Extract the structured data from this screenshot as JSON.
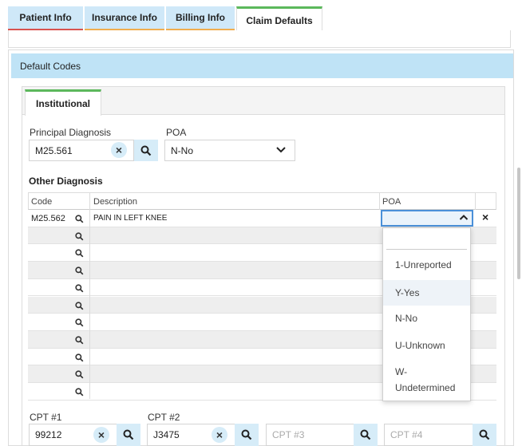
{
  "tabs": [
    {
      "label": "Patient Info",
      "underline": "#d9534f"
    },
    {
      "label": "Insurance Info",
      "underline": "#f0ad4e"
    },
    {
      "label": "Billing Info",
      "underline": "#f0ad4e"
    },
    {
      "label": "Claim Defaults",
      "underline": "#5cb85c"
    }
  ],
  "section": {
    "title": "Default Codes"
  },
  "inner_tab": {
    "label": "Institutional"
  },
  "principal": {
    "label": "Principal Diagnosis",
    "value": "M25.561",
    "poa_label": "POA",
    "poa_value": "N-No"
  },
  "other": {
    "title": "Other Diagnosis",
    "headers": {
      "code": "Code",
      "description": "Description",
      "poa": "POA"
    },
    "rows": [
      {
        "code": "M25.562",
        "description": "PAIN IN LEFT KNEE"
      },
      {
        "code": "",
        "description": ""
      },
      {
        "code": "",
        "description": ""
      },
      {
        "code": "",
        "description": ""
      },
      {
        "code": "",
        "description": ""
      },
      {
        "code": "",
        "description": ""
      },
      {
        "code": "",
        "description": ""
      },
      {
        "code": "",
        "description": ""
      },
      {
        "code": "",
        "description": ""
      },
      {
        "code": "",
        "description": ""
      },
      {
        "code": "",
        "description": ""
      }
    ]
  },
  "poa_dropdown": {
    "options": [
      "1-Unreported",
      "Y-Yes",
      "N-No",
      "U-Unknown",
      "W-\nUndetermined"
    ],
    "highlighted": "Y-Yes"
  },
  "cpt": [
    {
      "label": "CPT #1",
      "value": "99212",
      "placeholder": ""
    },
    {
      "label": "CPT #2",
      "value": "J3475",
      "placeholder": ""
    },
    {
      "label": "",
      "value": "",
      "placeholder": "CPT #3"
    },
    {
      "label": "",
      "value": "",
      "placeholder": "CPT #4"
    }
  ],
  "colors": {
    "accent": "#bfe3f6",
    "button": "#d6ecf8",
    "active_tab_bar": "#5cb85c"
  },
  "icons": {
    "search": "search-icon",
    "clear": "close-icon",
    "chevron": "chevron-down-icon"
  }
}
